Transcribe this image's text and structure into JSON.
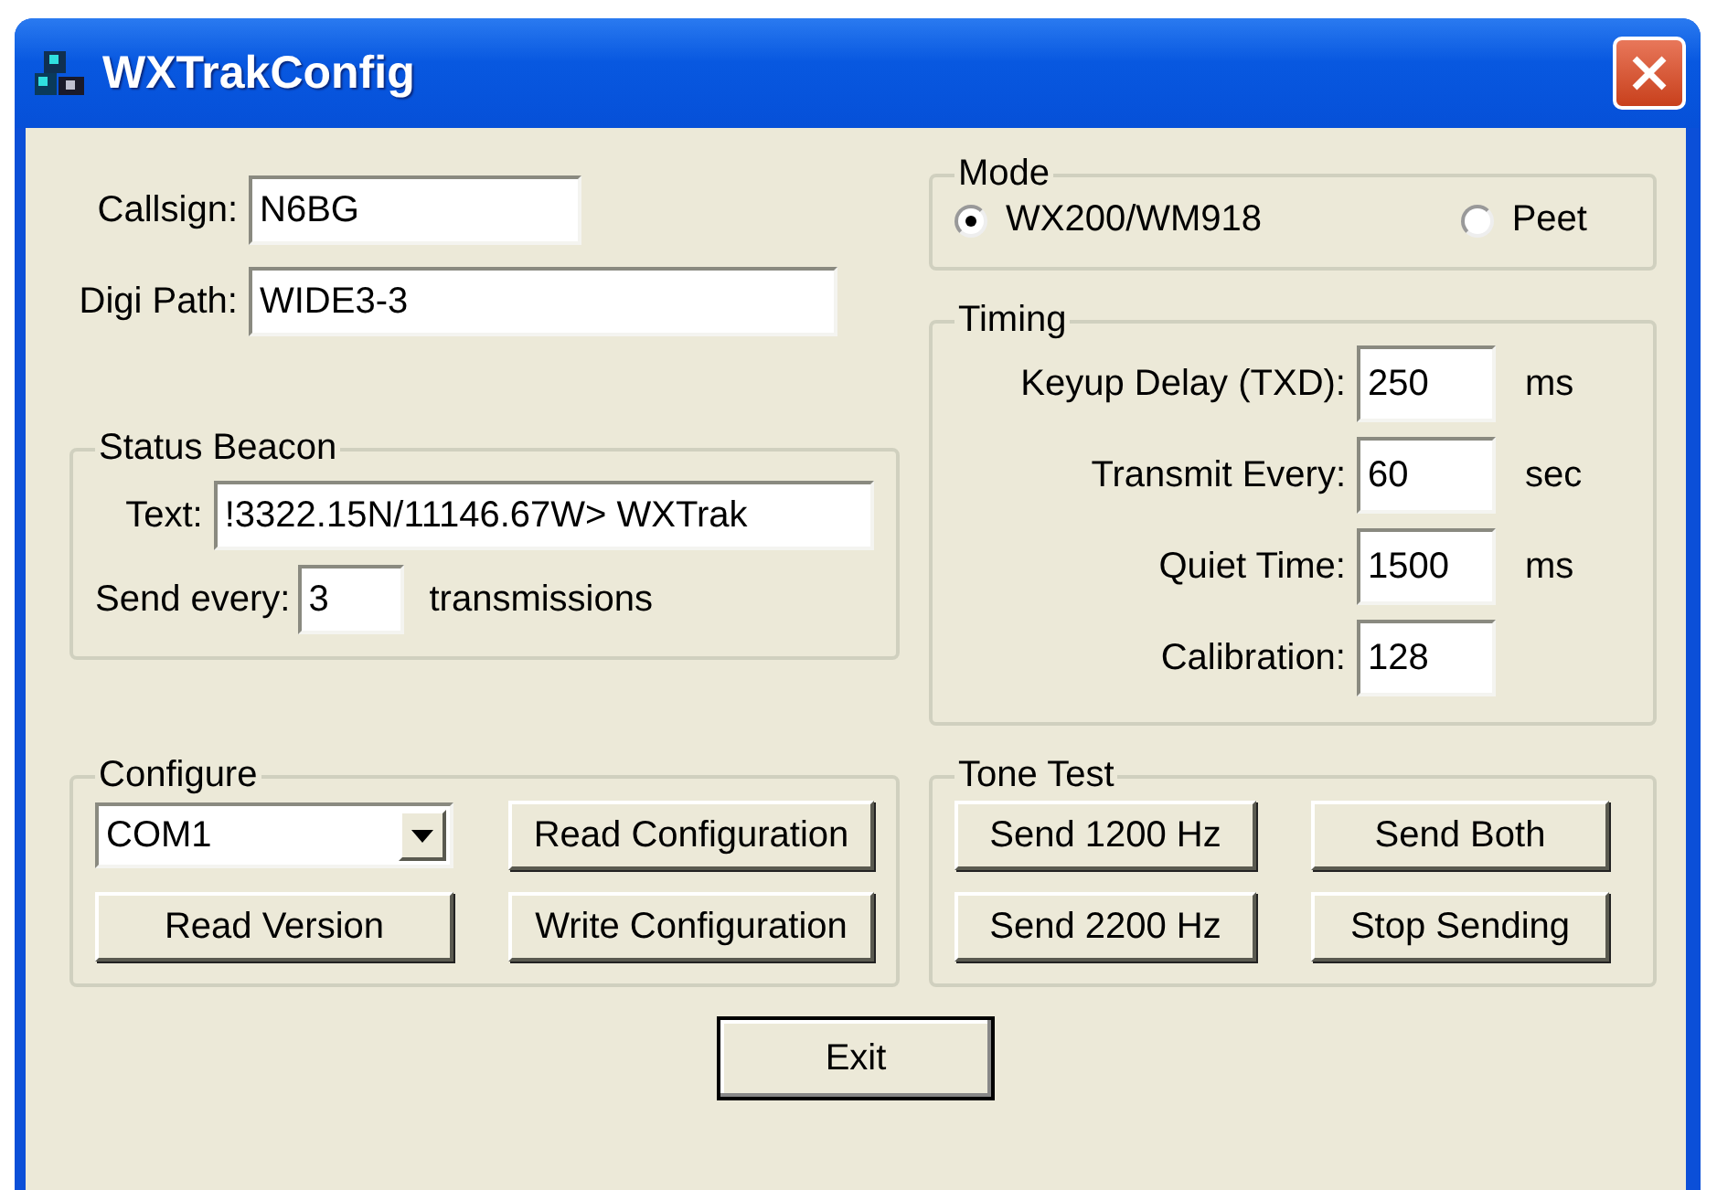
{
  "window": {
    "title": "WXTrakConfig"
  },
  "callsign": {
    "label": "Callsign:",
    "value": "N6BG"
  },
  "digi_path": {
    "label": "Digi Path:",
    "value": "WIDE3-3"
  },
  "status_beacon": {
    "title": "Status Beacon",
    "text": {
      "label": "Text:",
      "value": "!3322.15N/11146.67W> WXTrak"
    },
    "send_every": {
      "label": "Send every:",
      "value": "3",
      "unit": "transmissions"
    }
  },
  "mode": {
    "title": "Mode",
    "options": [
      {
        "label": "WX200/WM918",
        "selected": true
      },
      {
        "label": "Peet",
        "selected": false
      }
    ]
  },
  "timing": {
    "title": "Timing",
    "rows": [
      {
        "label": "Keyup Delay (TXD):",
        "value": "250",
        "unit": "ms"
      },
      {
        "label": "Transmit Every:",
        "value": "60",
        "unit": "sec"
      },
      {
        "label": "Quiet Time:",
        "value": "1500",
        "unit": "ms"
      },
      {
        "label": "Calibration:",
        "value": "128"
      }
    ]
  },
  "configure": {
    "title": "Configure",
    "port": "COM1",
    "buttons": [
      "Read Configuration",
      "Read Version",
      "Write Configuration"
    ]
  },
  "tone_test": {
    "title": "Tone Test",
    "buttons": [
      "Send 1200 Hz",
      "Send Both",
      "Send 2200 Hz",
      "Stop Sending"
    ]
  },
  "exit_button": "Exit"
}
